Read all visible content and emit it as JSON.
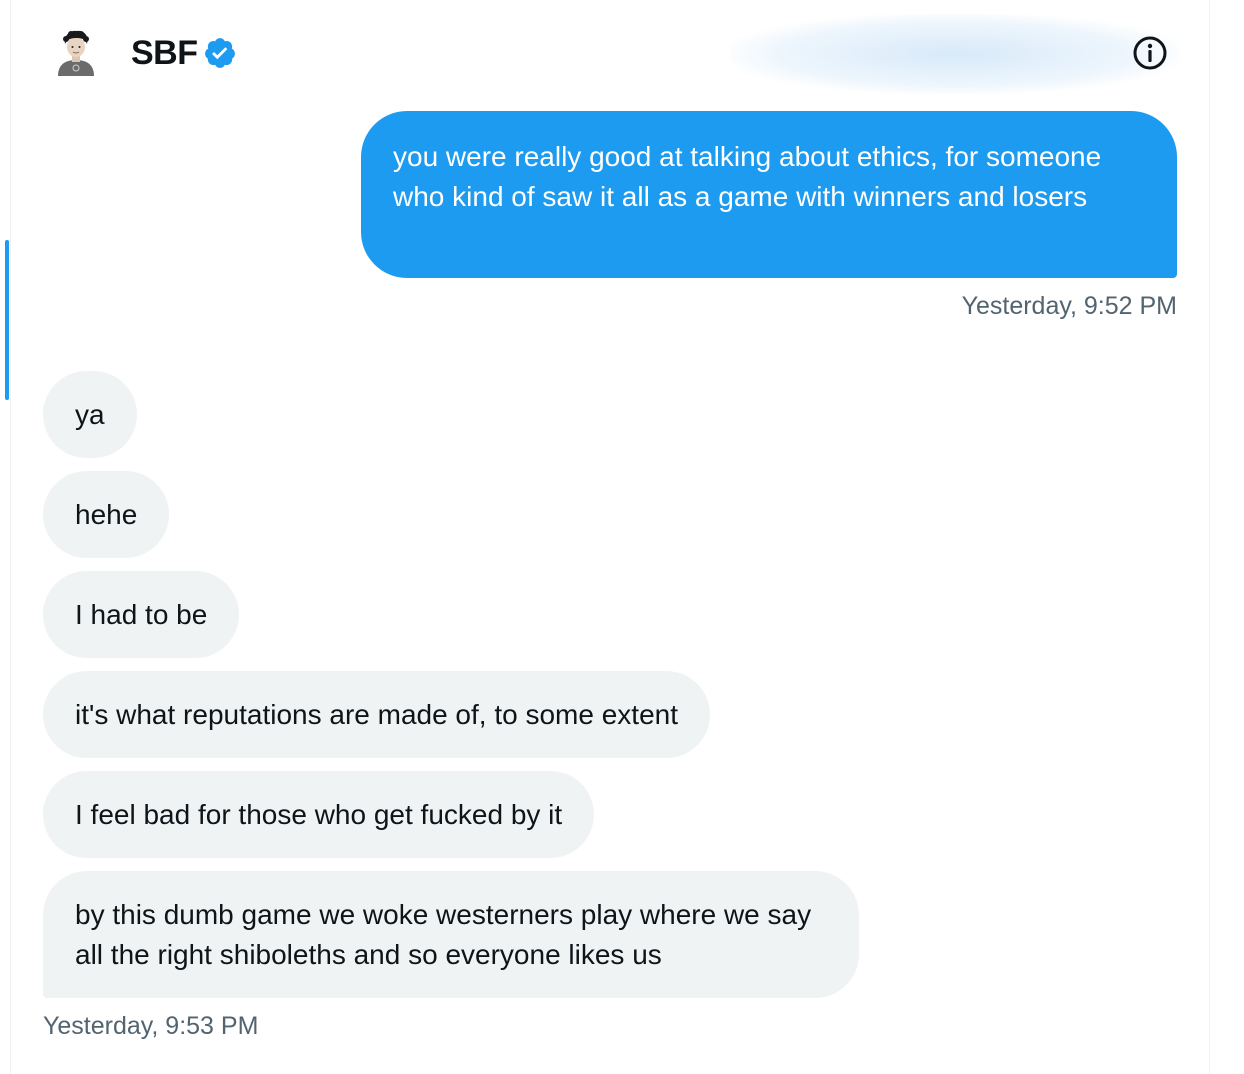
{
  "header": {
    "name": "SBF",
    "verified_icon": "verified-badge-icon",
    "info_icon": "info-icon",
    "colors": {
      "verified": "#1d9bf0"
    }
  },
  "messages": {
    "outgoing": [
      {
        "text": "you were really good at talking about ethics, for someone who kind of saw it all as a game with winners and losers"
      }
    ],
    "outgoing_time": "Yesterday, 9:52 PM",
    "incoming": [
      {
        "text": "ya"
      },
      {
        "text": "hehe"
      },
      {
        "text": "I had to be"
      },
      {
        "text": "it's what reputations are made of, to some extent"
      },
      {
        "text": "I feel bad for those who get fucked by it"
      },
      {
        "text": "by this dumb game we woke westerners play where we say all the right shiboleths and so everyone likes us"
      }
    ],
    "incoming_time": "Yesterday, 9:53 PM"
  },
  "colors": {
    "outgoing_bubble": "#1d9bf0",
    "incoming_bubble": "#eff3f4",
    "timestamp": "#536471"
  }
}
